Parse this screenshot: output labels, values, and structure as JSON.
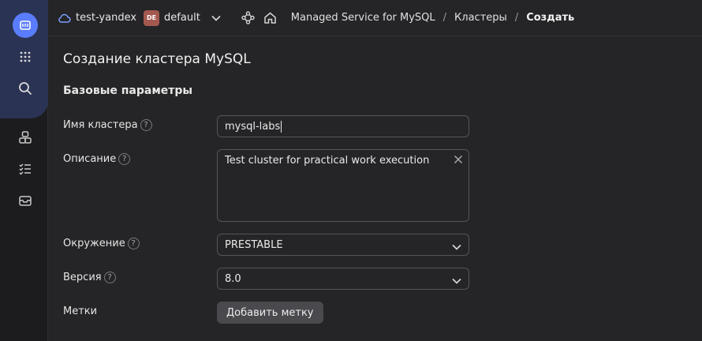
{
  "header": {
    "cloud_name": "test-yandex",
    "folder_badge": "DE",
    "folder_name": "default",
    "breadcrumbs": [
      {
        "label": "Managed Service for MySQL"
      },
      {
        "label": "Кластеры"
      },
      {
        "label": "Создать"
      }
    ],
    "separator": "/"
  },
  "page": {
    "title": "Создание кластера MySQL",
    "section_title": "Базовые параметры"
  },
  "form": {
    "help_glyph": "?",
    "cluster_name": {
      "label": "Имя кластера",
      "value": "mysql-labs"
    },
    "description": {
      "label": "Описание",
      "value": "Test cluster for practical work execution"
    },
    "environment": {
      "label": "Окружение",
      "value": "PRESTABLE"
    },
    "version": {
      "label": "Версия",
      "value": "8.0"
    },
    "labels": {
      "label": "Метки",
      "button": "Добавить метку"
    }
  },
  "icons": {
    "rail": [
      "logo-icon",
      "apps-grid-icon",
      "search-icon",
      "services-icon",
      "checklist-icon",
      "inbox-icon"
    ],
    "topbar": [
      "cloud-icon",
      "chevron-down-icon",
      "network-icon",
      "home-icon"
    ]
  },
  "colors": {
    "accent": "#5a7dff",
    "background": "#252527",
    "rail": "#1c1c1e",
    "folder_badge": "#a4594f"
  }
}
